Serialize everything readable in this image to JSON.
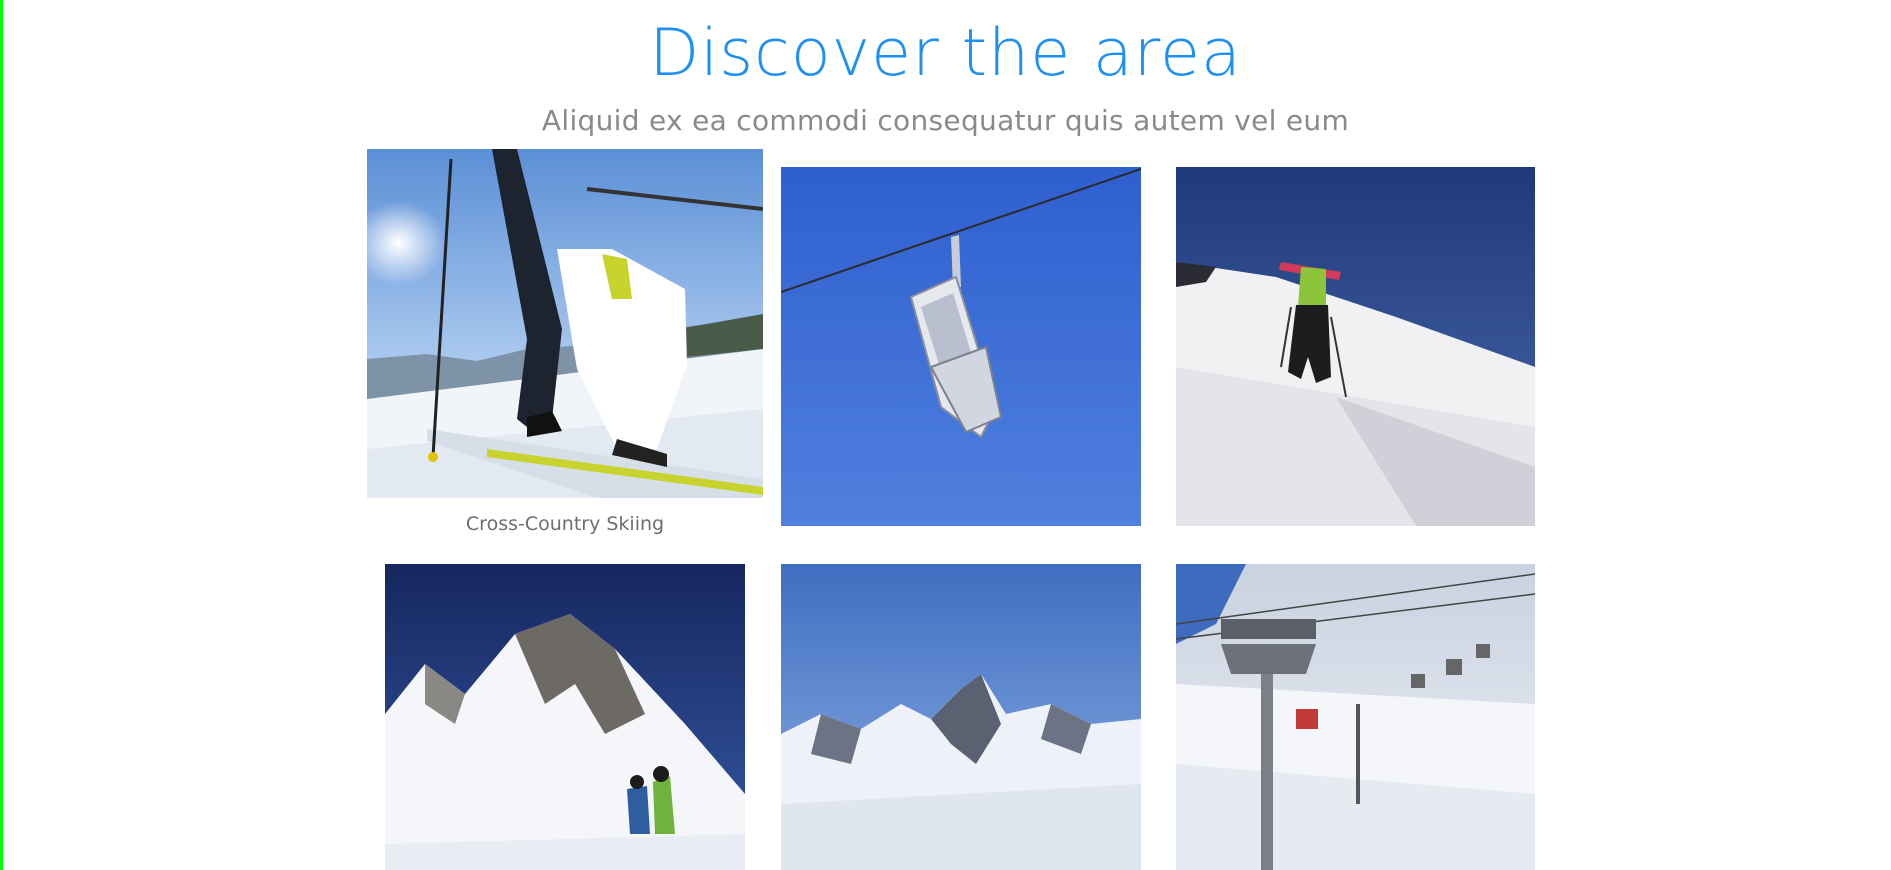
{
  "section": {
    "title": "Discover the area",
    "subtitle": "Aliquid ex ea commodi consequatur quis autem vel eum"
  },
  "gallery": {
    "items": [
      {
        "photo": "cross-country-skiing-photo",
        "caption": "Cross-Country Skiing",
        "hovered": true
      },
      {
        "photo": "chairlift-photo"
      },
      {
        "photo": "ski-hiker-photo"
      },
      {
        "photo": "snowy-peak-skiers-photo"
      },
      {
        "photo": "mountain-range-photo"
      },
      {
        "photo": "ski-lift-line-photo"
      }
    ]
  },
  "colors": {
    "title": "#1e90f0",
    "subtitle": "#8a8a8a",
    "caption": "#6e6e6e",
    "left_edge": "#00ff00"
  }
}
